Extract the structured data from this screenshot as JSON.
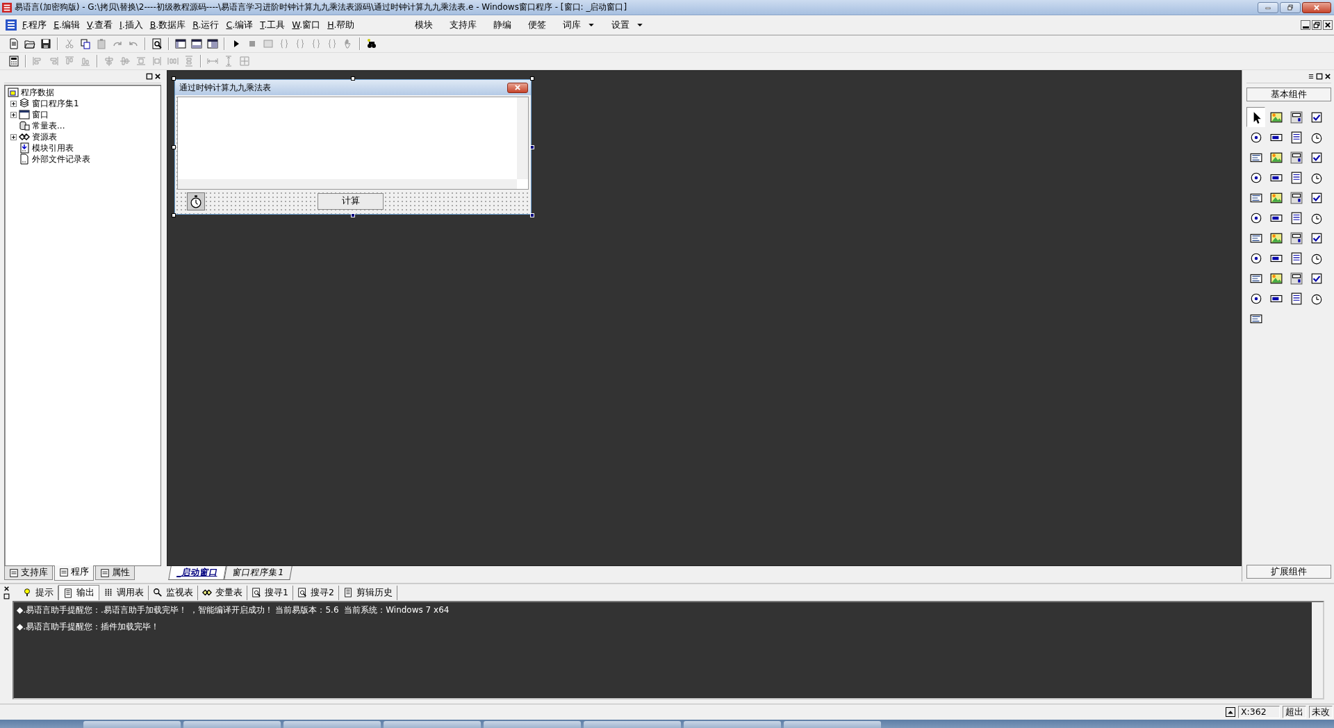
{
  "window": {
    "title": "易语言(加密狗版) - G:\\拷贝\\替换\\2----初级教程源码----\\易语言学习进阶时钟计算九九乘法表源码\\通过时钟计算九九乘法表.e - Windows窗口程序 - [窗口: _启动窗口]"
  },
  "menu": [
    {
      "key": "F",
      "rest": ".程序"
    },
    {
      "key": "E",
      "rest": ".编辑"
    },
    {
      "key": "V",
      "rest": ".查看"
    },
    {
      "key": "I",
      "rest": ".插入"
    },
    {
      "key": "B",
      "rest": ".数据库"
    },
    {
      "key": "R",
      "rest": ".运行"
    },
    {
      "key": "C",
      "rest": ".编译"
    },
    {
      "key": "T",
      "rest": ".工具"
    },
    {
      "key": "W",
      "rest": ".窗口"
    },
    {
      "key": "H",
      "rest": ".帮助"
    }
  ],
  "quick_menu": [
    {
      "label": "模块",
      "dropdown": false
    },
    {
      "label": "支持库",
      "dropdown": false
    },
    {
      "label": "静编",
      "dropdown": false
    },
    {
      "label": "便签",
      "dropdown": false
    },
    {
      "label": "词库",
      "dropdown": true
    },
    {
      "label": "设置",
      "dropdown": true
    }
  ],
  "project_tree": {
    "label": "程序数据",
    "children": [
      {
        "label": "窗口程序集1",
        "kind": "group",
        "expanded": false
      },
      {
        "label": "窗口",
        "kind": "group",
        "expanded": false
      },
      {
        "label": "常量表...",
        "kind": "leaf"
      },
      {
        "label": "资源表",
        "kind": "group",
        "expanded": false
      },
      {
        "label": "模块引用表",
        "kind": "leaf"
      },
      {
        "label": "外部文件记录表",
        "kind": "leaf"
      }
    ]
  },
  "left_tabs": [
    {
      "label": "支持库",
      "selected": false
    },
    {
      "label": "程序",
      "selected": true
    },
    {
      "label": "属性",
      "selected": false
    }
  ],
  "designer": {
    "form": {
      "title": "通过时钟计算九九乘法表",
      "button": "计算"
    },
    "tabs": [
      {
        "label": "_启动窗口",
        "selected": true
      },
      {
        "label": "窗口程序集1",
        "selected": false
      }
    ]
  },
  "palette": {
    "title": "基本组件",
    "footer": "扩展组件",
    "items": [
      {
        "selected": true
      },
      {
        "selected": false
      },
      {
        "selected": false
      },
      {
        "selected": false
      },
      {
        "selected": false
      },
      {
        "selected": false
      },
      {
        "selected": false
      },
      {
        "selected": false
      },
      {
        "selected": false
      },
      {
        "selected": false
      },
      {
        "selected": false
      },
      {
        "selected": false
      },
      {
        "selected": false
      },
      {
        "selected": false
      },
      {
        "selected": false
      },
      {
        "selected": false
      },
      {
        "selected": false
      },
      {
        "selected": false
      },
      {
        "selected": false
      },
      {
        "selected": false
      },
      {
        "selected": false
      },
      {
        "selected": false
      },
      {
        "selected": false
      },
      {
        "selected": false
      },
      {
        "selected": false
      },
      {
        "selected": false
      },
      {
        "selected": false
      },
      {
        "selected": false
      },
      {
        "selected": false
      },
      {
        "selected": false
      },
      {
        "selected": false
      },
      {
        "selected": false
      },
      {
        "selected": false
      },
      {
        "selected": false
      },
      {
        "selected": false
      },
      {
        "selected": false
      },
      {
        "selected": false
      },
      {
        "selected": false
      },
      {
        "selected": false
      },
      {
        "selected": false
      },
      {
        "selected": false
      }
    ]
  },
  "output": {
    "tabs": [
      {
        "label": "提示",
        "selected": false
      },
      {
        "label": "输出",
        "selected": true
      },
      {
        "label": "调用表",
        "selected": false
      },
      {
        "label": "监视表",
        "selected": false
      },
      {
        "label": "变量表",
        "selected": false
      },
      {
        "label": "搜寻1",
        "selected": false
      },
      {
        "label": "搜寻2",
        "selected": false
      },
      {
        "label": "剪辑历史",
        "selected": false
      }
    ],
    "lines": [
      "◆.易语言助手提醒您：.易语言助手加载完毕！ ，智能编译开启成功！ 当前易版本：5.6  当前系统：Windows 7 x64",
      "◆.易语言助手提醒您：插件加载完毕！"
    ]
  },
  "status_bar": {
    "position": "X:362",
    "overflow": "超出",
    "modified": "未改"
  }
}
